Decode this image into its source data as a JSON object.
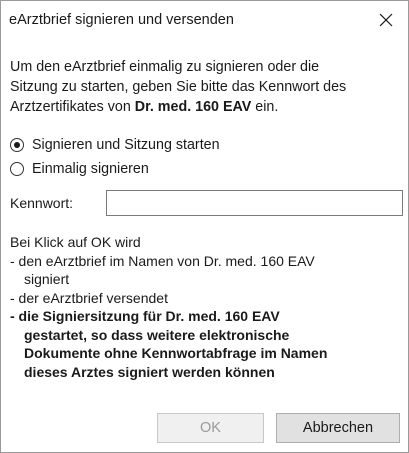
{
  "window": {
    "title": "eArztbrief signieren und versenden",
    "close_icon": "close-icon"
  },
  "intro": {
    "line1": "Um den eArztbrief einmalig zu signieren oder die",
    "line2": "Sitzung zu starten, geben Sie bitte das Kennwort des",
    "line3_prefix": "Arztzertifikates von ",
    "line3_doctor": "Dr. med. 160 EAV",
    "line3_suffix": " ein."
  },
  "options": [
    {
      "label": "Signieren und Sitzung starten",
      "selected": true
    },
    {
      "label": "Einmalig signieren",
      "selected": false
    }
  ],
  "password": {
    "label": "Kennwort:",
    "value": ""
  },
  "info": {
    "line1": "Bei Klick auf OK wird",
    "line2": "- den eArztbrief im Namen von Dr. med. 160 EAV",
    "line3": "signiert",
    "line4": "- der eArztbrief versendet",
    "line5": "- die Signiersitzung für Dr. med. 160 EAV",
    "line6": "gestartet, so dass weitere elektronische",
    "line7": "Dokumente ohne Kennwortabfrage im Namen",
    "line8": "dieses Arztes signiert werden können"
  },
  "buttons": {
    "ok": {
      "label": "OK",
      "enabled": false
    },
    "cancel": {
      "label": "Abbrechen",
      "enabled": true
    }
  }
}
